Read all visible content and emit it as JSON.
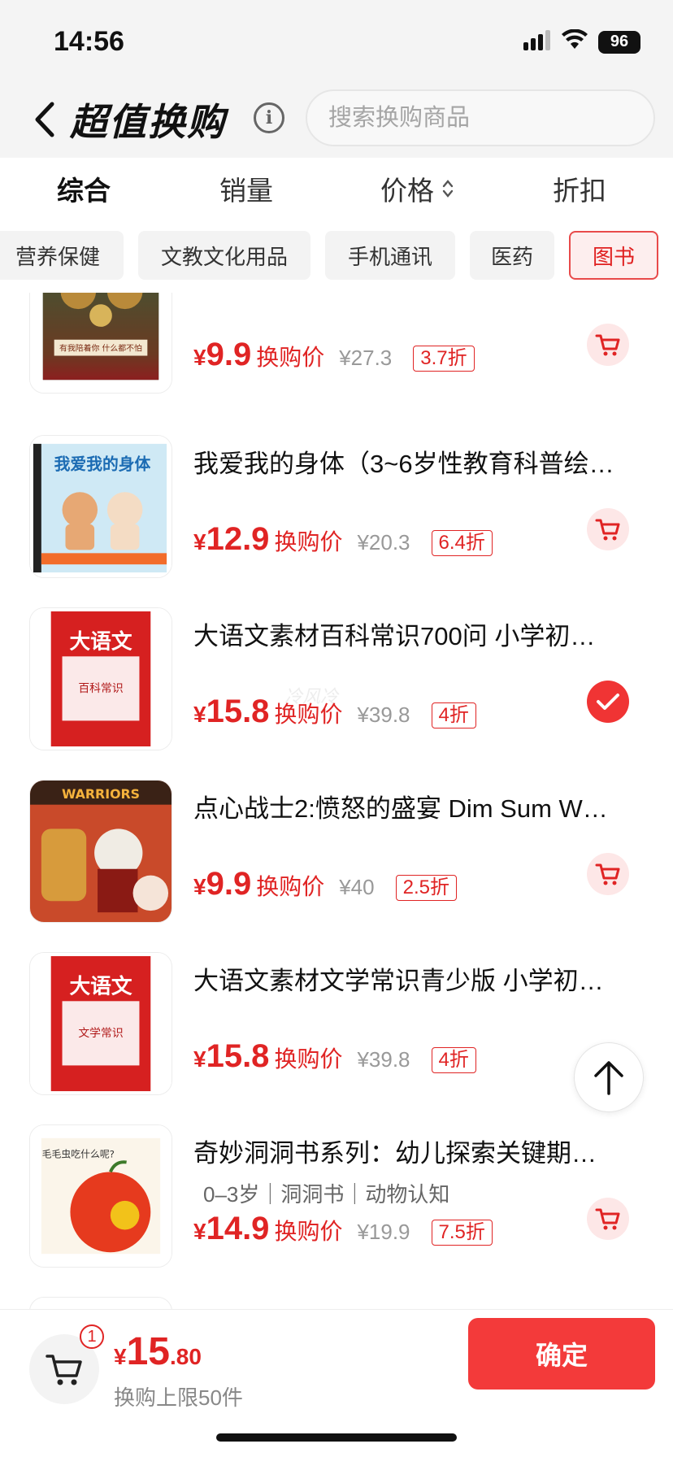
{
  "status_bar": {
    "time": "14:56",
    "battery": "96"
  },
  "header": {
    "title": "超值换购",
    "search_placeholder": "搜索换购商品"
  },
  "sort_tabs": [
    {
      "label": "综合",
      "active": true
    },
    {
      "label": "销量"
    },
    {
      "label": "价格"
    },
    {
      "label": "折扣"
    }
  ],
  "categories": [
    {
      "label": "营养保健"
    },
    {
      "label": "文教文化用品"
    },
    {
      "label": "手机通讯"
    },
    {
      "label": "医药"
    },
    {
      "label": "图书",
      "active": true
    }
  ],
  "price_label": "换购价",
  "currency": "¥",
  "products": [
    {
      "title": "",
      "price": "9.9",
      "orig": "¥27.3",
      "discount": "3.7折",
      "action": "cart",
      "cover_text": "有我陪着你 什么都不怕"
    },
    {
      "title": "我爱我的身体（3~6岁性教育科普绘…",
      "price": "12.9",
      "orig": "¥20.3",
      "discount": "6.4折",
      "action": "cart",
      "cover_text": "我爱我的身体"
    },
    {
      "title": "大语文素材百科常识700问 小学初…",
      "price": "15.8",
      "orig": "¥39.8",
      "discount": "4折",
      "action": "checked",
      "cover_text": "大语文",
      "cover_sub": "百科常识",
      "watermark": "冷风冷"
    },
    {
      "title": "点心战士2:愤怒的盛宴 Dim Sum W…",
      "price": "9.9",
      "orig": "¥40",
      "discount": "2.5折",
      "action": "cart",
      "cover_text": "WARRIORS"
    },
    {
      "title": "大语文素材文学常识青少版 小学初…",
      "price": "15.8",
      "orig": "¥39.8",
      "discount": "4折",
      "action": "none",
      "cover_text": "大语文",
      "cover_sub": "文学常识"
    },
    {
      "title": "奇妙洞洞书系列：幼儿探索关键期…",
      "tags": "0–3岁｜洞洞书｜动物认知",
      "price": "14.9",
      "orig": "¥19.9",
      "discount": "7.5折",
      "action": "cart",
      "cover_text": "毛毛虫吃什么呢?"
    }
  ],
  "bottom": {
    "badge": "1",
    "total_yen": "¥",
    "total_int": "15",
    "total_dec": ".80",
    "limit": "换购上限50件",
    "confirm": "确定"
  },
  "colors": {
    "accent": "#e02424",
    "button": "#f33a3a",
    "chip_active_bg": "#fdeeee"
  }
}
